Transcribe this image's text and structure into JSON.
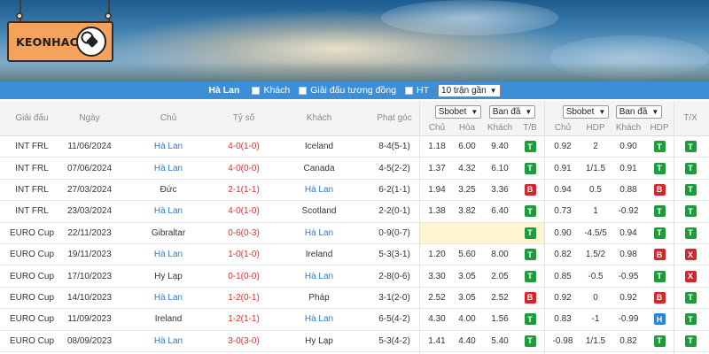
{
  "brand": {
    "logo_text": "KEONHACAI"
  },
  "filter": {
    "team": "Hà Lan",
    "away_label": "Khách",
    "same_league_label": "Giải đấu tương đồng",
    "ht_label": "HT",
    "matches_select": "10 trận gần"
  },
  "header": {
    "league": "Giải đấu",
    "date": "Ngày",
    "home": "Chủ",
    "score": "Tỷ số",
    "away": "Khách",
    "corner": "Phạt góc",
    "bookmaker1": "Sbobet",
    "market1": "Ban đầ",
    "sub_home": "Chủ",
    "sub_draw": "Hòa",
    "sub_away": "Khách",
    "sub_tb": "T/B",
    "bookmaker2": "Sbobet",
    "market2": "Ban đầ",
    "sub_chu2": "Chủ",
    "sub_hdp": "HDP",
    "sub_khach2": "Khách",
    "sub_hdp2": "HDP",
    "tx": "T/X"
  },
  "rows": [
    {
      "league": "INT FRL",
      "date": "11/06/2024",
      "home": "Hà Lan",
      "score": "4-0(1-0)",
      "away": "Iceland",
      "corner": "8-4(5-1)",
      "o1": "1.18",
      "o2": "6.00",
      "o3": "9.40",
      "tb": "T",
      "a1": "0.92",
      "hdp": "2",
      "a2": "0.90",
      "hdpr": "T",
      "tx": "T"
    },
    {
      "league": "INT FRL",
      "date": "07/06/2024",
      "home": "Hà Lan",
      "score": "4-0(0-0)",
      "away": "Canada",
      "corner": "4-5(2-2)",
      "o1": "1.37",
      "o2": "4.32",
      "o3": "6.10",
      "tb": "T",
      "a1": "0.91",
      "hdp": "1/1.5",
      "a2": "0.91",
      "hdpr": "T",
      "tx": "T"
    },
    {
      "league": "INT FRL",
      "date": "27/03/2024",
      "home": "Đức",
      "score": "2-1(1-1)",
      "away": "Hà Lan",
      "corner": "6-2(1-1)",
      "o1": "1.94",
      "o2": "3.25",
      "o3": "3.36",
      "tb": "B",
      "a1": "0.94",
      "hdp": "0.5",
      "a2": "0.88",
      "hdpr": "B",
      "tx": "T"
    },
    {
      "league": "INT FRL",
      "date": "23/03/2024",
      "home": "Hà Lan",
      "score": "4-0(1-0)",
      "away": "Scotland",
      "corner": "2-2(0-1)",
      "o1": "1.38",
      "o2": "3.82",
      "o3": "6.40",
      "tb": "T",
      "a1": "0.73",
      "hdp": "1",
      "a2": "-0.92",
      "hdpr": "T",
      "tx": "T"
    },
    {
      "league": "EURO Cup",
      "date": "22/11/2023",
      "home": "Gibraltar",
      "score": "0-6(0-3)",
      "away": "Hà Lan",
      "corner": "0-9(0-7)",
      "o1": "",
      "o2": "",
      "o3": "",
      "tb": "T",
      "a1": "0.90",
      "hdp": "-4.5/5",
      "a2": "0.94",
      "hdpr": "T",
      "tx": "T"
    },
    {
      "league": "EURO Cup",
      "date": "19/11/2023",
      "home": "Hà Lan",
      "score": "1-0(1-0)",
      "away": "Ireland",
      "corner": "5-3(3-1)",
      "o1": "1.20",
      "o2": "5.60",
      "o3": "8.00",
      "tb": "T",
      "a1": "0.82",
      "hdp": "1.5/2",
      "a2": "0.98",
      "hdpr": "B",
      "tx": "X"
    },
    {
      "league": "EURO Cup",
      "date": "17/10/2023",
      "home": "Hy Lạp",
      "score": "0-1(0-0)",
      "away": "Hà Lan",
      "corner": "2-8(0-6)",
      "o1": "3.30",
      "o2": "3.05",
      "o3": "2.05",
      "tb": "T",
      "a1": "0.85",
      "hdp": "-0.5",
      "a2": "-0.95",
      "hdpr": "T",
      "tx": "X"
    },
    {
      "league": "EURO Cup",
      "date": "14/10/2023",
      "home": "Hà Lan",
      "score": "1-2(0-1)",
      "away": "Pháp",
      "corner": "3-1(2-0)",
      "o1": "2.52",
      "o2": "3.05",
      "o3": "2.52",
      "tb": "B",
      "a1": "0.92",
      "hdp": "0",
      "a2": "0.92",
      "hdpr": "B",
      "tx": "T"
    },
    {
      "league": "EURO Cup",
      "date": "11/09/2023",
      "home": "Ireland",
      "score": "1-2(1-1)",
      "away": "Hà Lan",
      "corner": "6-5(4-2)",
      "o1": "4.30",
      "o2": "4.00",
      "o3": "1.56",
      "tb": "T",
      "a1": "0.83",
      "hdp": "-1",
      "a2": "-0.99",
      "hdpr": "H",
      "tx": "T"
    },
    {
      "league": "EURO Cup",
      "date": "08/09/2023",
      "home": "Hà Lan",
      "score": "3-0(3-0)",
      "away": "Hy Lạp",
      "corner": "5-3(4-2)",
      "o1": "1.41",
      "o2": "4.40",
      "o3": "5.40",
      "tb": "T",
      "a1": "-0.98",
      "hdp": "1/1.5",
      "a2": "0.82",
      "hdpr": "T",
      "tx": "T"
    }
  ],
  "colors": {
    "filter_bar": "#3c8fd6",
    "win": "#1e9b3a",
    "loss": "#d7262b",
    "draw": "#2b84d6",
    "team_highlight": "#2a7ad8"
  }
}
